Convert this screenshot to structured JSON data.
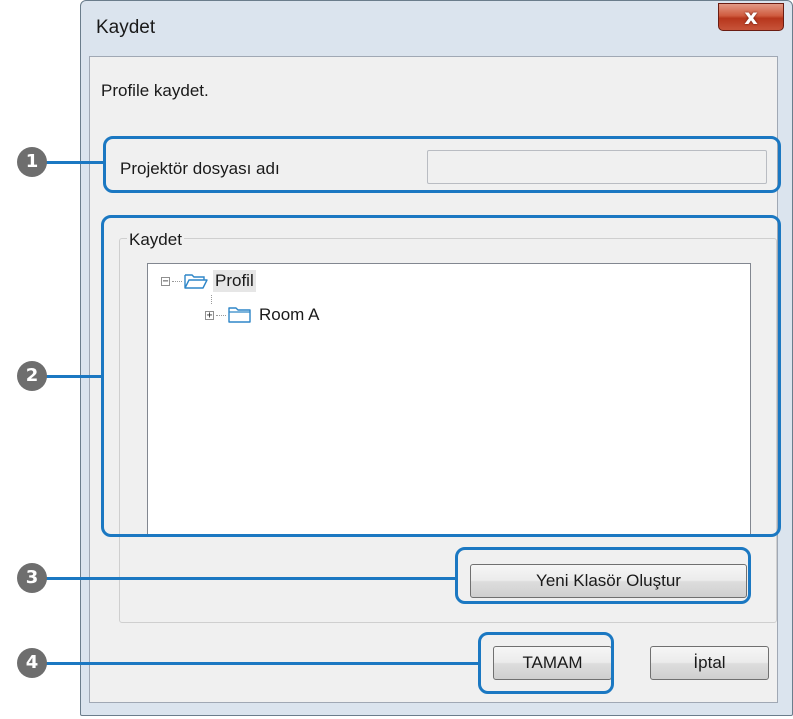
{
  "window": {
    "title": "Kaydet",
    "close_glyph": "x",
    "close_icon": "close-icon"
  },
  "description": "Profile kaydet.",
  "projector_file": {
    "label": "Projektör dosyası adı",
    "value": ""
  },
  "save_group": {
    "label": "Kaydet",
    "tree": [
      {
        "label": "Profil",
        "expander": "−",
        "icon": "folder-open-icon",
        "selected": true
      },
      {
        "label": "Room A",
        "expander": "+",
        "icon": "folder-icon",
        "selected": false
      }
    ]
  },
  "buttons": {
    "new_folder": "Yeni Klasör Oluştur",
    "ok": "TAMAM",
    "cancel": "İptal"
  },
  "callouts": [
    "1",
    "2",
    "3",
    "4"
  ],
  "colors": {
    "callout_ring": "#1b78c2",
    "callout_badge": "#6e6e6e",
    "close_button": "#c7543a",
    "client_bg": "#f0f0f0"
  }
}
